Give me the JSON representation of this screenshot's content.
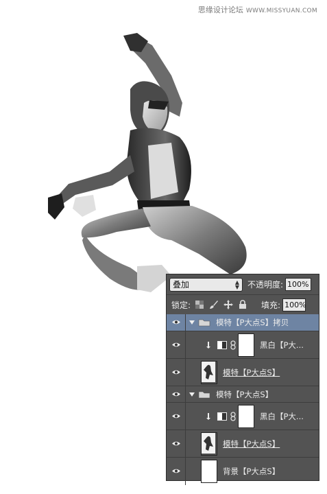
{
  "watermark": {
    "text": "思缘设计论坛",
    "site": "WWW.MISSYUAN.COM"
  },
  "panel": {
    "blend_mode": "叠加",
    "opacity_label": "不透明度:",
    "opacity_value": "100%",
    "lock_label": "锁定:",
    "fill_label": "填充:",
    "fill_value": "100%"
  },
  "layers": [
    {
      "type": "group",
      "name": "模特【P大点S】拷贝",
      "selected": true,
      "expanded": true
    },
    {
      "type": "adjustment",
      "name": "黑白【P大...",
      "clipped": true
    },
    {
      "type": "image",
      "name": "模特【P大点S】"
    },
    {
      "type": "group",
      "name": "模特【P大点S】",
      "expanded": true
    },
    {
      "type": "adjustment",
      "name": "黑白【P大...",
      "clipped": true
    },
    {
      "type": "image",
      "name": "模特【P大点S】"
    },
    {
      "type": "background",
      "name": "背景【P大点S】"
    }
  ],
  "colors": {
    "panel_bg": "#535353",
    "selected_row": "#6e84a3"
  }
}
